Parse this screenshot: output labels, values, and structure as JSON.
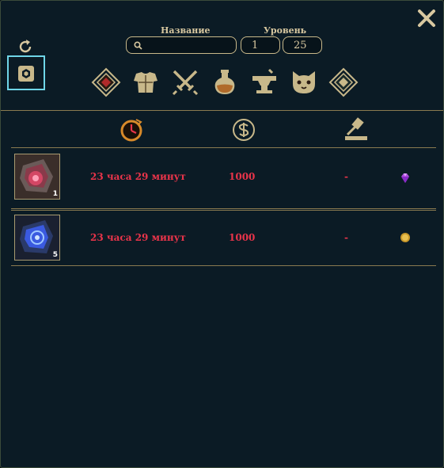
{
  "header": {
    "name_label": "Название",
    "level_label": "Уровень"
  },
  "search": {
    "value": "",
    "placeholder": ""
  },
  "level": {
    "min": "1",
    "max": "25"
  },
  "columns": [
    "time-remaining",
    "price",
    "bid"
  ],
  "rows": [
    {
      "time": "23 часа 29 минут",
      "price": "1000",
      "bid": "-",
      "qty": "1",
      "currency_icon": "gem-icon",
      "item_color": "#e04a6a"
    },
    {
      "time": "23 часа 29 минут",
      "price": "1000",
      "bid": "-",
      "qty": "5",
      "currency_icon": "gold-coin-icon",
      "item_color": "#3a6ae0"
    }
  ],
  "colors": {
    "accent": "#c8b88a",
    "text_red": "#e8344a",
    "background": "#0b1b25",
    "highlight": "#6fd6e8"
  }
}
